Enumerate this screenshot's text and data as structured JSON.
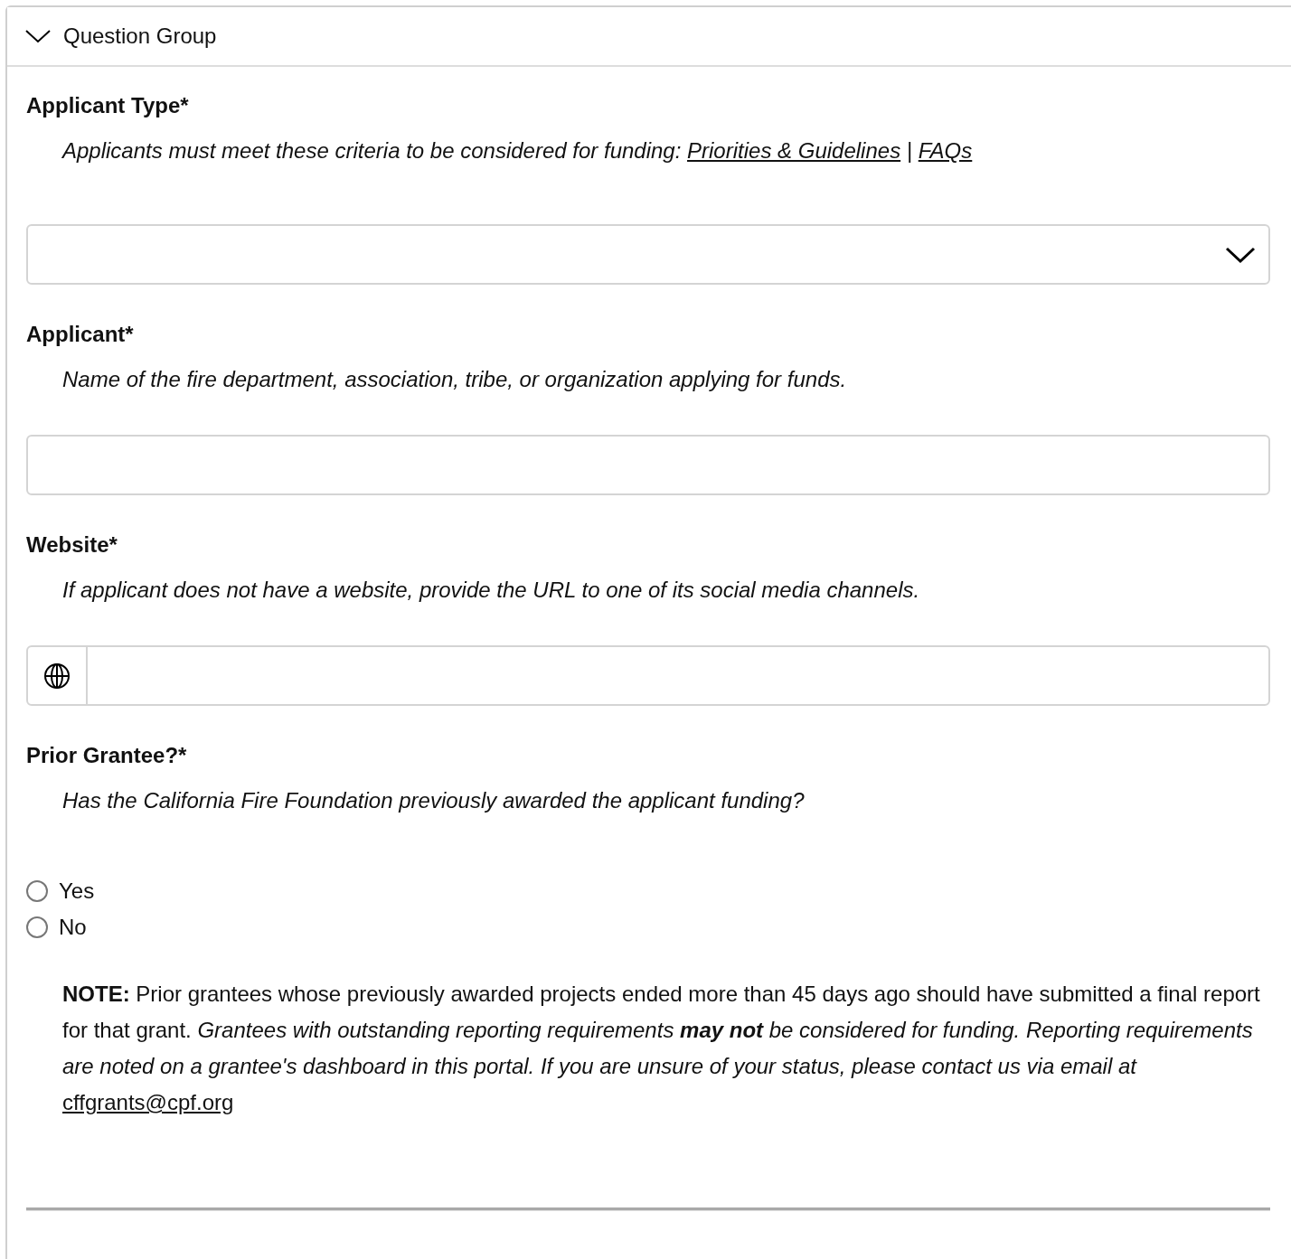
{
  "section": {
    "title": "Question Group",
    "expanded": true
  },
  "questions": [
    {
      "kind": "select",
      "label": "Applicant Type*",
      "description": [
        {
          "kind": "text",
          "text": "Applicants must meet these criteria to be considered for funding: "
        },
        {
          "kind": "link",
          "text": "Priorities & Guidelines"
        },
        {
          "kind": "text",
          "text": " | "
        },
        {
          "kind": "link",
          "text": "FAQs"
        }
      ]
    },
    {
      "kind": "text",
      "label": "Applicant*",
      "description": [
        {
          "kind": "text",
          "text": "Name of the fire department, association, tribe, or organization applying for funds."
        }
      ]
    },
    {
      "kind": "url",
      "label": "Website*",
      "description": [
        {
          "kind": "text",
          "text": "If applicant does not have a website, provide the URL to one of its social media channels."
        }
      ]
    },
    {
      "kind": "radio",
      "label": "Prior Grantee?*",
      "description": [
        {
          "kind": "text",
          "text": "Has the California Fire Foundation previously awarded the applicant funding?"
        }
      ],
      "options": [
        {
          "label": "Yes",
          "selected": false
        },
        {
          "label": "No",
          "selected": false
        }
      ],
      "note": [
        {
          "kind": "plain",
          "text": "**NOTE:** Prior grantees whose previously awarded projects ended more than 45 days ago should have submitted a final report for that grant. "
        },
        {
          "kind": "italic",
          "text": "Grantees with outstanding reporting requirements **may not** be considered for funding. Reporting requirements are noted on a grantee's dashboard in this portal. If you are unsure of your status, please contact us via email at "
        },
        {
          "kind": "link",
          "text": "cffgrants@cpf.org"
        }
      ]
    }
  ]
}
